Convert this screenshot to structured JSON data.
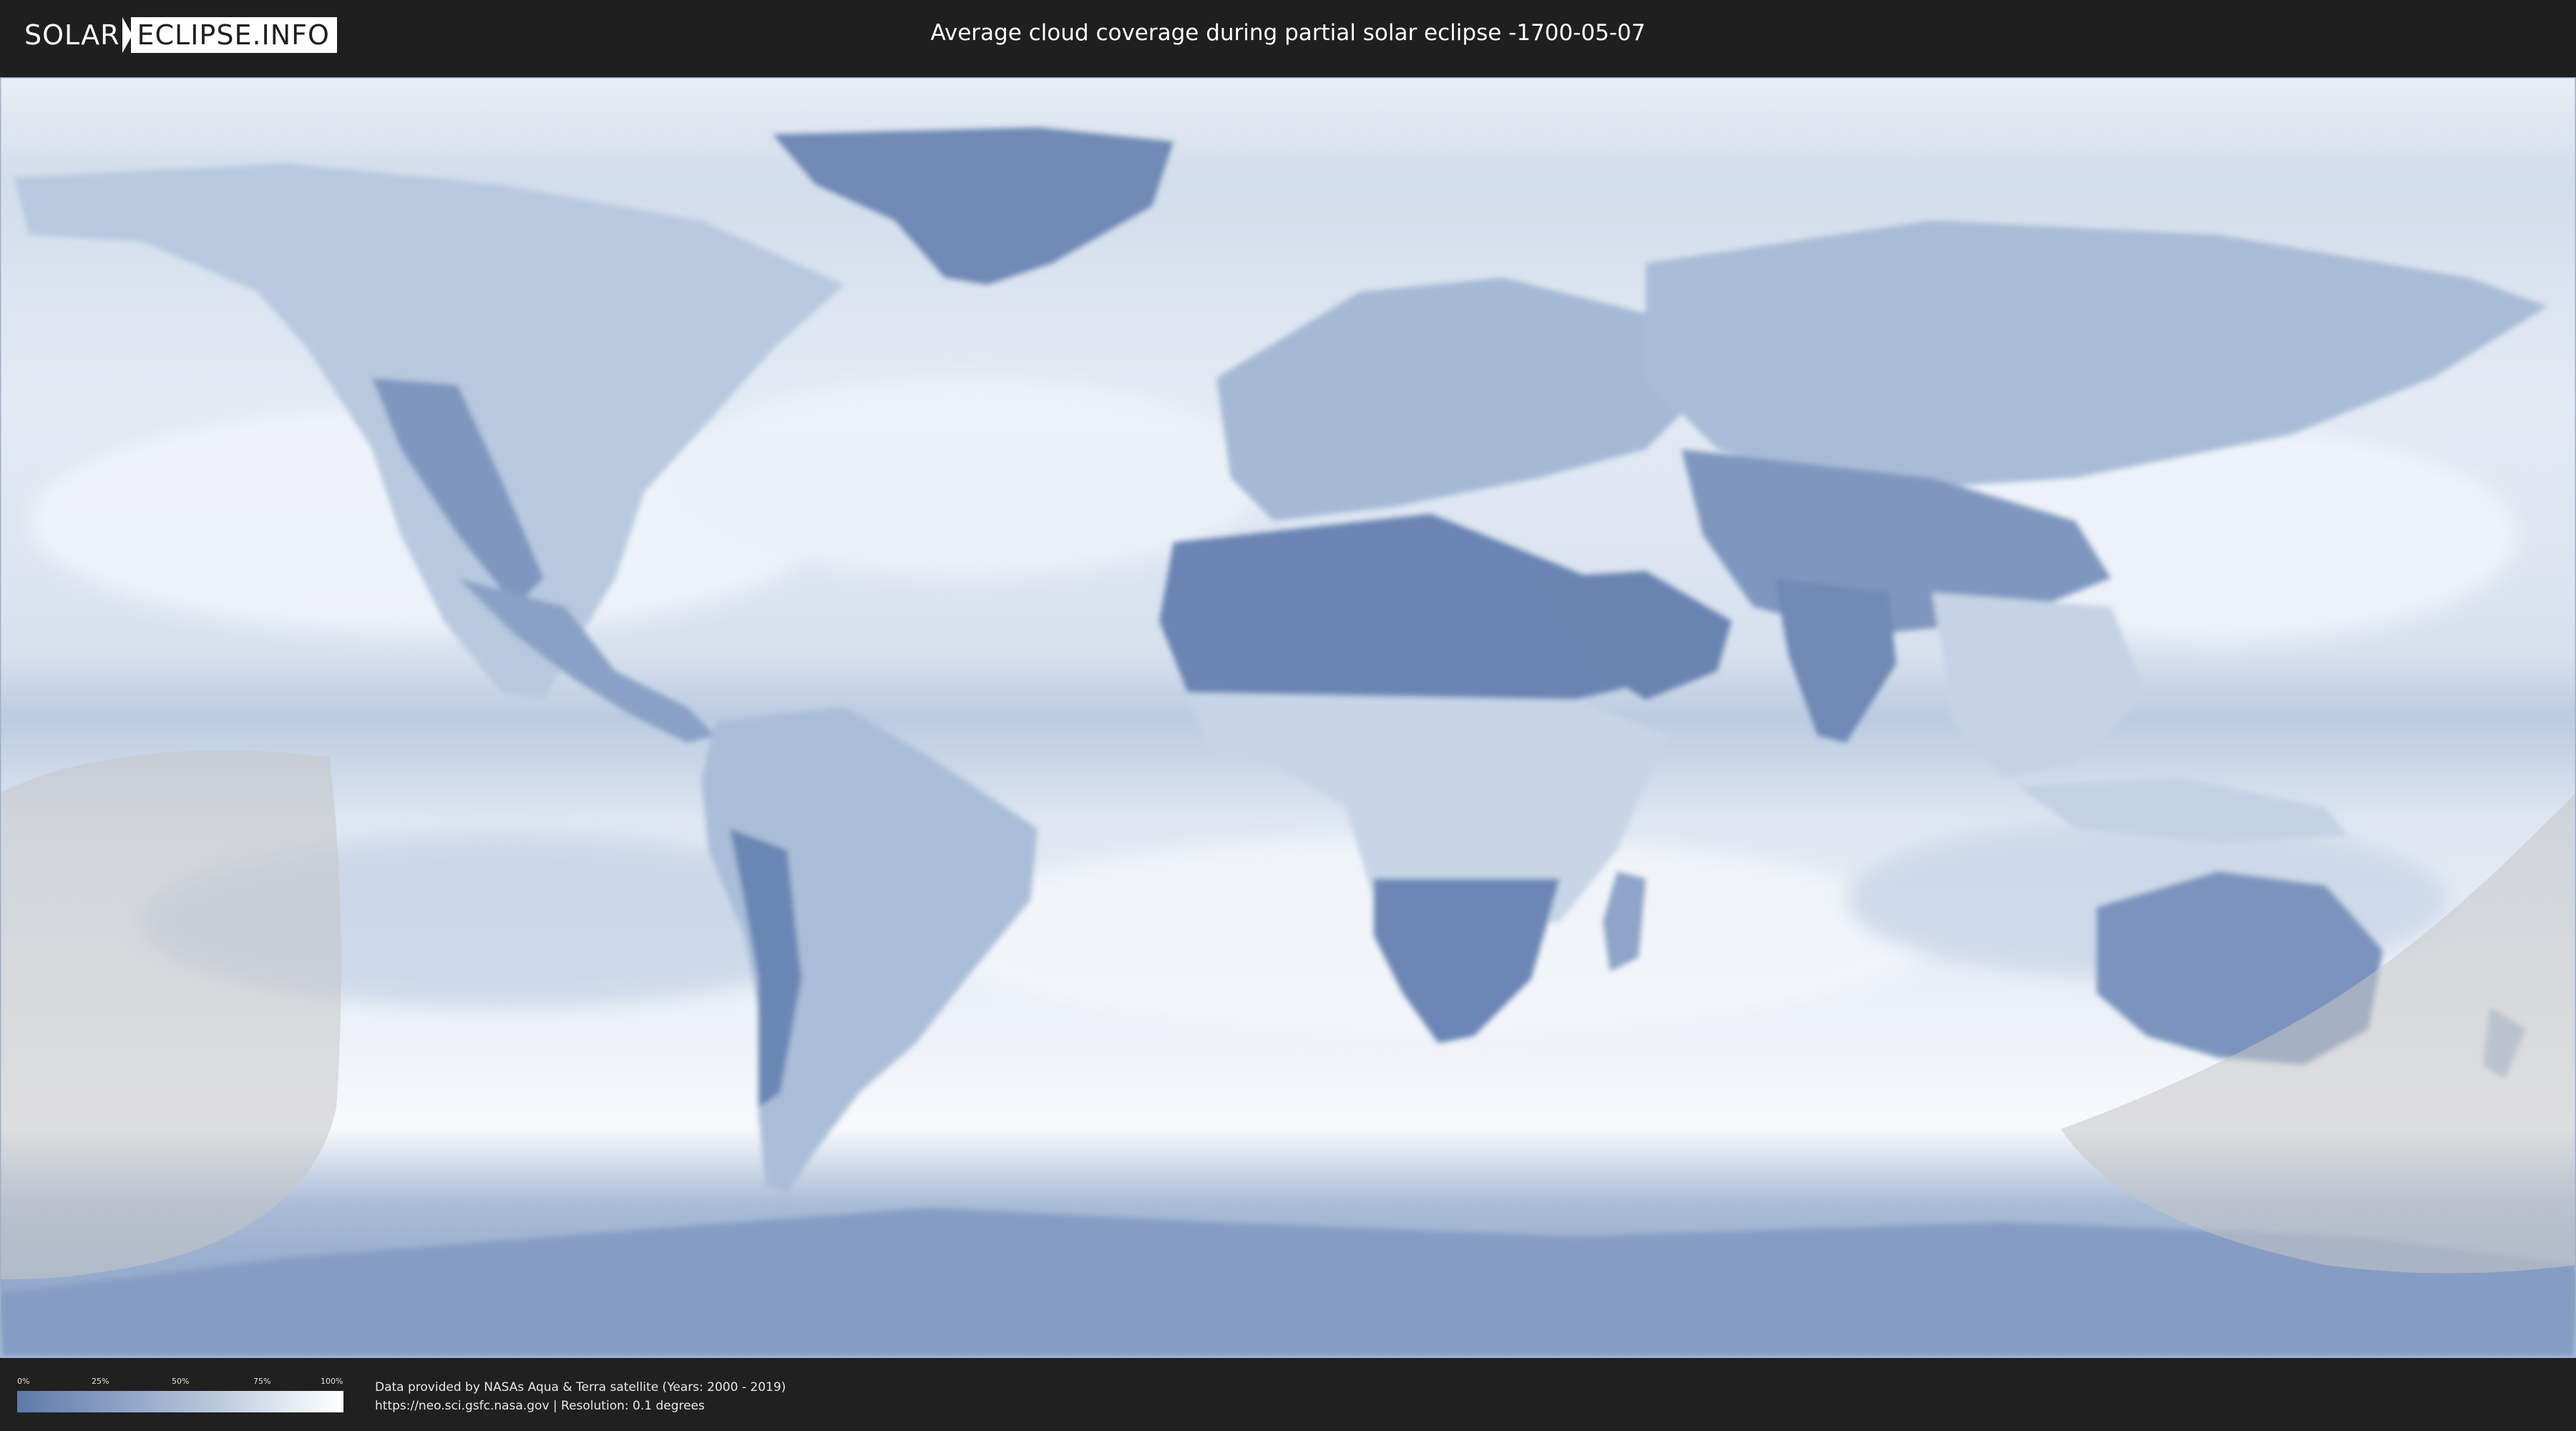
{
  "logo": {
    "part1": "SOLAR",
    "part2": "ECLIPSE.INFO"
  },
  "title": "Average cloud coverage during partial solar eclipse -1700-05-07",
  "legend": {
    "ticks": [
      "0%",
      "25%",
      "50%",
      "75%",
      "100%"
    ],
    "gradient_colors": [
      "#6079a8",
      "#8aa0c4",
      "#b9c7dc",
      "#e6ecf4",
      "#ffffff"
    ]
  },
  "credit": {
    "line1": "Data provided by NASAs Aqua & Terra satellite (Years: 2000 - 2019)",
    "line2": "https://neo.sci.gsfc.nasa.gov | Resolution: 0.1 degrees"
  },
  "colors": {
    "background": "#1f1f1f",
    "ocean_cloud": "#dde6f1",
    "land_clear": "#6a84b2",
    "eclipse_overlay": "#c9c9c9"
  }
}
